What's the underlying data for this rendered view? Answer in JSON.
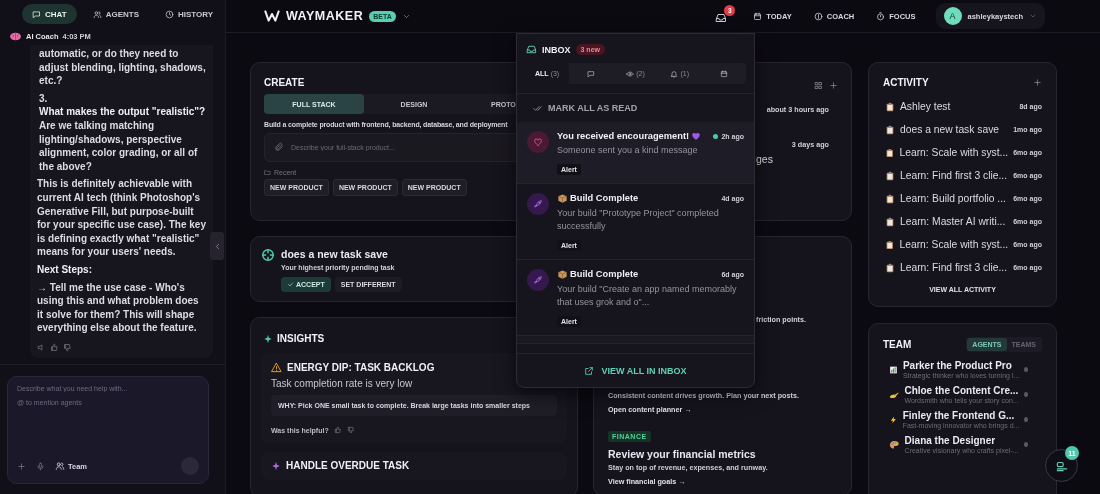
{
  "left_panel": {
    "tabs": [
      {
        "label": "CHAT",
        "kind": "chat",
        "selected": true
      },
      {
        "label": "AGENTS",
        "kind": "users",
        "selected": false
      },
      {
        "label": "HISTORY",
        "kind": "clock",
        "selected": false
      }
    ],
    "message_header": {
      "sender": "AI Coach",
      "time": "4:03 PM"
    },
    "message": [
      {
        "kind": "list_tail",
        "text": "automatic, or do they need to adjust blending, lighting, shadows, etc.?"
      },
      {
        "kind": "numbered",
        "number": "3.",
        "title": "What makes the output \"realistic\"?",
        "text": "Are we talking matching lighting/shadows, perspective alignment, color grading, or all of the above?"
      },
      {
        "kind": "paragraph",
        "text": "This is definitely achievable with current AI tech (think Photoshop's Generative Fill, but purpose-built for your specific use case). The key is defining exactly what \"realistic\" means for your users' needs."
      },
      {
        "kind": "heading",
        "text": "Next Steps:"
      },
      {
        "kind": "paragraph",
        "text": "→ **Tell me the use case** - Who's using this and what problem does it solve for them? This will shape everything else about the feature."
      }
    ],
    "composer": {
      "placeholder": "Describe what you need help with...",
      "hint": "@ to mention agents",
      "team_label": "Team"
    }
  },
  "header": {
    "brand": "WAYMAKER",
    "badge": "BETA",
    "inbox_count": "3",
    "nav": [
      {
        "label": "TODAY",
        "kind": "calendar"
      },
      {
        "label": "COACH",
        "kind": "coach"
      },
      {
        "label": "FOCUS",
        "kind": "timer"
      }
    ],
    "user": {
      "initial": "A",
      "name": "ashleykaystech"
    }
  },
  "create": {
    "title": "CREATE",
    "tabs": [
      {
        "label": "FULL STACK",
        "selected": true
      },
      {
        "label": "DESIGN",
        "selected": false
      },
      {
        "label": "PROTO",
        "selected": false
      }
    ],
    "description": "Build a complete product with frontend, backend, database, and deployment",
    "placeholder": "Describe your full-stack product...",
    "recent_label": "Recent",
    "recent": [
      "NEW PRODUCT",
      "NEW PRODUCT",
      "NEW PRODUCT"
    ]
  },
  "task": {
    "title": "does a new task save",
    "subtitle": "Your highest priority pending task",
    "actions": [
      {
        "label": "ACCEPT",
        "kind": "primary"
      },
      {
        "label": "SET DIFFERENT",
        "kind": "secondary"
      }
    ]
  },
  "insights": {
    "title": "INSIGHTS",
    "items": [
      {
        "kind": "warning",
        "title": "ENERGY DIP: TASK BACKLOG",
        "summary": "Task completion rate is very low",
        "why": "WHY: Pick ONE small task to complete. Break large tasks into smaller steps",
        "feedback": "Was this helpful?"
      },
      {
        "kind": "sparkle",
        "title": "HANDLE OVERDUE TASK"
      }
    ]
  },
  "updates_card": {
    "rows": [
      {
        "time": "about 3 hours ago"
      },
      {
        "time": "3 days ago",
        "title_tail": "ges"
      }
    ]
  },
  "suggestions_card": {
    "first_tail": "friction points.",
    "items": [
      {
        "text": "Consistent content drives growth. Plan your next posts.",
        "link": "Open content planner →"
      },
      {
        "tag": "FINANCE",
        "title": "Review your financial metrics",
        "text": "Stay on top of revenue, expenses, and runway.",
        "link": "View financial goals →"
      }
    ]
  },
  "activity": {
    "title": "ACTIVITY",
    "items": [
      {
        "title": "Ashley test",
        "time": "8d ago"
      },
      {
        "title": "does a new task save",
        "time": "1mo ago"
      },
      {
        "title": "Learn: Scale with syst...",
        "time": "6mo ago"
      },
      {
        "title": "Learn: Find first 3 clie...",
        "time": "6mo ago"
      },
      {
        "title": "Learn: Build portfolio ...",
        "time": "6mo ago"
      },
      {
        "title": "Learn: Master AI writi...",
        "time": "6mo ago"
      },
      {
        "title": "Learn: Scale with syst...",
        "time": "6mo ago"
      },
      {
        "title": "Learn: Find first 3 clie...",
        "time": "6mo ago"
      }
    ],
    "footer": "VIEW ALL ACTIVITY"
  },
  "team": {
    "title": "TEAM",
    "tabs": [
      {
        "label": "AGENTS",
        "selected": true
      },
      {
        "label": "TEAMS",
        "selected": false
      }
    ],
    "members": [
      {
        "kind": "chart",
        "name": "Parker the Product Pro",
        "description": "Strategic thinker who loves turning i..."
      },
      {
        "kind": "writing",
        "name": "Chloe the Content Cre...",
        "description": "Wordsmith who tells your story con..."
      },
      {
        "kind": "lightning",
        "name": "Finley the Frontend G...",
        "description": "Fast-moving innovator who brings d..."
      },
      {
        "kind": "palette",
        "name": "Diana the Designer",
        "description": "Creative visionary who crafts pixel-..."
      }
    ]
  },
  "assistant_button": {
    "badge": "11"
  },
  "inbox": {
    "title": "INBOX",
    "new_badge": "3 new",
    "filters": [
      {
        "kind": "all",
        "label": "ALL",
        "count": "(3)",
        "selected": true
      },
      {
        "kind": "chat",
        "selected": false
      },
      {
        "kind": "eye",
        "count": "(2)",
        "selected": false
      },
      {
        "kind": "bell",
        "count": "(1)",
        "selected": false
      },
      {
        "kind": "calendar",
        "selected": false
      }
    ],
    "mark_all": "MARK ALL AS READ",
    "items": [
      {
        "kind": "encouragement",
        "title": "You received encouragement!",
        "time": "2h ago",
        "unread": true,
        "text": "Someone sent you a kind message",
        "tag": "Alert"
      },
      {
        "kind": "build",
        "title": "Build Complete",
        "time": "4d ago",
        "unread": false,
        "text": "Your build \"Prototype Project\" completed successfully",
        "tag": "Alert"
      },
      {
        "kind": "build",
        "title": "Build Complete",
        "time": "6d ago",
        "unread": false,
        "text": "Your build \"Create an app named memorably that uses grok and o\"...",
        "tag": "Alert"
      }
    ],
    "footer": "VIEW ALL IN INBOX"
  }
}
